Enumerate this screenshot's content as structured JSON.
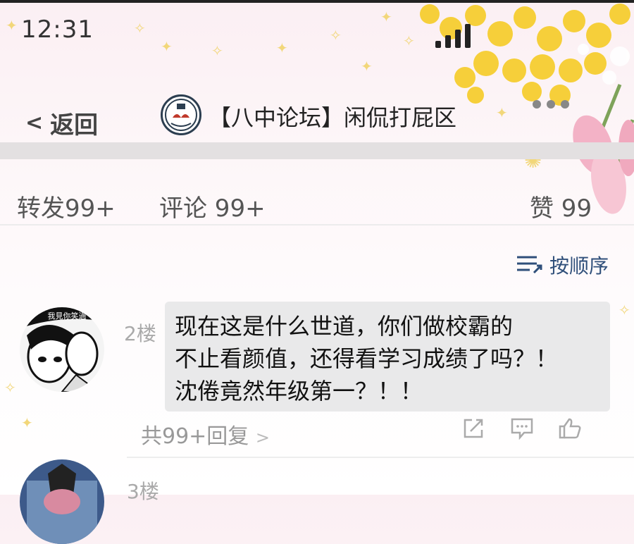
{
  "status": {
    "time": "12:31"
  },
  "header": {
    "back_label": "返回",
    "back_chevron": "<",
    "forum_title": "【八中论坛】闲侃打屁区",
    "more_icon": "more-dots-icon"
  },
  "stats": {
    "repost": "转发99+",
    "comment": "评论 99+",
    "like": "赞 99"
  },
  "sort": {
    "label": "按顺序",
    "icon": "sort-order-icon"
  },
  "comments": [
    {
      "floor": "2楼",
      "avatar_caption": "我見你笑過",
      "lines": [
        "现在这是什么世道，你们做校霸的",
        "不止看颜值，还得看学习成绩了吗？！",
        "沈倦竟然年级第一？！！"
      ],
      "replies": "共99+回复",
      "reply_chevron": ">",
      "actions": [
        "share-icon",
        "comment-icon",
        "like-icon"
      ]
    },
    {
      "floor": "3楼"
    }
  ],
  "colors": {
    "accent_link": "#2f4f7a",
    "bubble_bg": "#e9e9ea",
    "flower_yellow": "#f6cf3a",
    "tulip_pink": "#f3b2c6"
  }
}
